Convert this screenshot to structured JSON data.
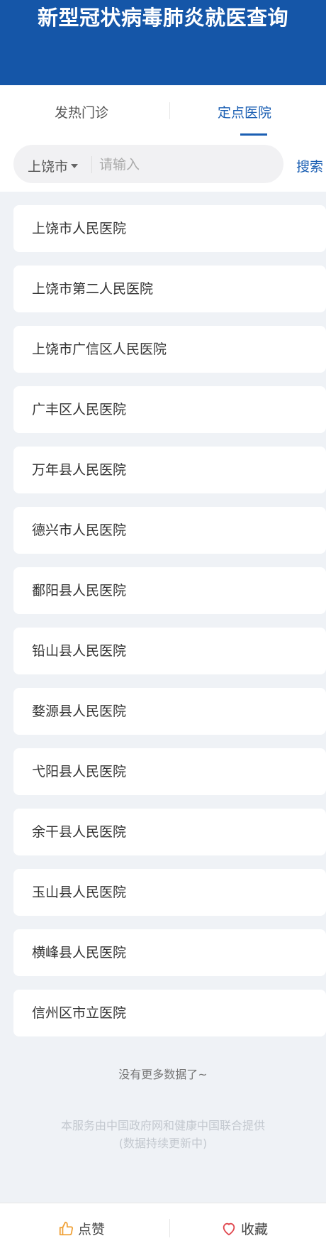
{
  "header": {
    "title": "新型冠状病毒肺炎就医查询"
  },
  "tabs": [
    {
      "label": "发热门诊"
    },
    {
      "label": "定点医院"
    }
  ],
  "search": {
    "city": "上饶市",
    "placeholder": "请输入",
    "button_label": "搜索"
  },
  "hospitals": [
    {
      "name": "上饶市人民医院"
    },
    {
      "name": "上饶市第二人民医院"
    },
    {
      "name": "上饶市广信区人民医院"
    },
    {
      "name": "广丰区人民医院"
    },
    {
      "name": "万年县人民医院"
    },
    {
      "name": "德兴市人民医院"
    },
    {
      "name": "鄱阳县人民医院"
    },
    {
      "name": "铅山县人民医院"
    },
    {
      "name": "婺源县人民医院"
    },
    {
      "name": "弋阳县人民医院"
    },
    {
      "name": "余干县人民医院"
    },
    {
      "name": "玉山县人民医院"
    },
    {
      "name": "横峰县人民医院"
    },
    {
      "name": "信州区市立医院"
    }
  ],
  "list_end_text": "没有更多数据了~",
  "footer": {
    "line1": "本服务由中国政府网和健康中国联合提供",
    "line2": "(数据持续更新中)"
  },
  "bottom_bar": {
    "like_label": "点赞",
    "favorite_label": "收藏"
  },
  "colors": {
    "header": "#1556a8",
    "accent": "#1b5fb3",
    "like_icon": "#f0a23a",
    "favorite_icon": "#e0484f"
  },
  "icons": {
    "like": "thumbs-up-icon",
    "favorite": "heart-icon",
    "city_dropdown": "caret-down-icon"
  }
}
